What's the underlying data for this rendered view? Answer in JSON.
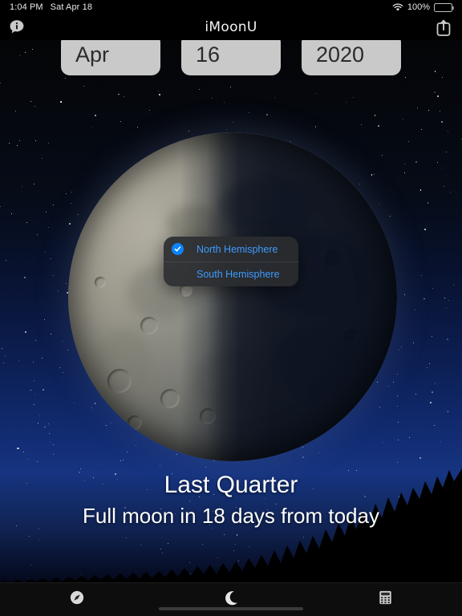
{
  "status_bar": {
    "time": "1:04 PM",
    "date": "Sat Apr 18",
    "battery_percent": "100%",
    "wifi_icon": "wifi-icon",
    "battery_icon": "battery-icon"
  },
  "nav_bar": {
    "title": "iMoonU",
    "left_icon": "info-bubble-icon",
    "right_icon": "share-icon"
  },
  "date_picker": {
    "month": "Apr",
    "day": "16",
    "year": "2020"
  },
  "hemisphere_popup": {
    "options": [
      {
        "label": "North Hemisphere",
        "selected": true
      },
      {
        "label": "South Hemisphere",
        "selected": false
      }
    ],
    "accent_color": "#0a84ff",
    "text_color": "#3e9bff",
    "background_color": "#2a2c30"
  },
  "moon_info": {
    "phase": "Last Quarter",
    "next_event": "Full moon in 18 days from today"
  },
  "tab_bar": {
    "tabs": [
      {
        "name": "compass-tab",
        "icon": "compass-icon",
        "active": false
      },
      {
        "name": "moon-tab",
        "icon": "crescent-moon-icon",
        "active": true
      },
      {
        "name": "calculator-tab",
        "icon": "calculator-icon",
        "active": false
      }
    ]
  },
  "theme": {
    "sky_top": "#040507",
    "sky_bottom": "#16337f",
    "button_bg": "#c9c9c9",
    "button_text": "#2b2b2b",
    "tabbar_bg": "#0d0d0d"
  }
}
